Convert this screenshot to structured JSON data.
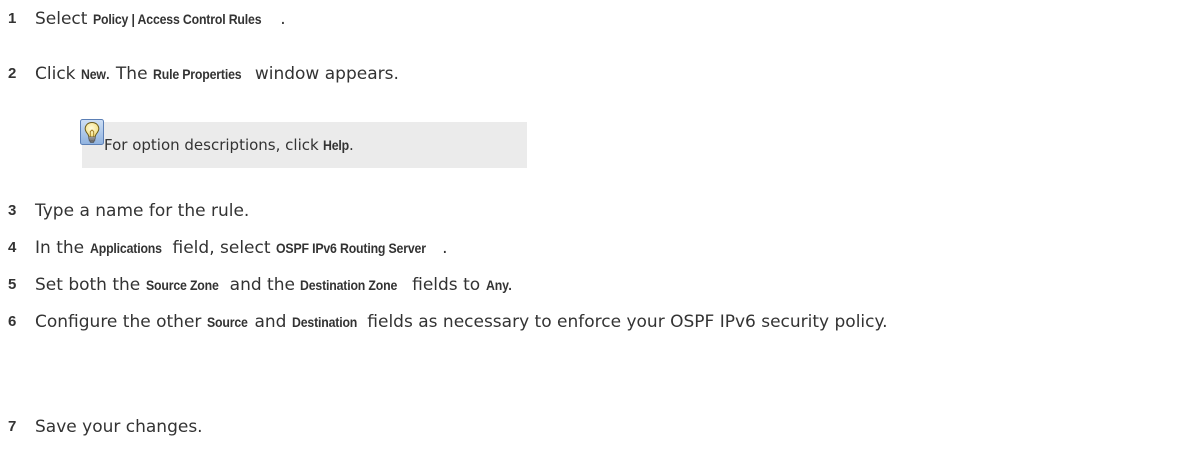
{
  "steps": [
    {
      "num": "1",
      "parts": [
        {
          "t": "Select "
        },
        {
          "t": "Policy | Access Control Rules",
          "ui": true
        },
        {
          "t": "."
        }
      ]
    },
    {
      "num": "2",
      "parts": [
        {
          "t": "Click "
        },
        {
          "t": "New",
          "ui": true
        },
        {
          "t": ". The "
        },
        {
          "t": "Rule Properties",
          "ui": true
        },
        {
          "t": " window appears."
        }
      ]
    },
    {
      "num": "3",
      "parts": [
        {
          "t": "Type a name for the rule."
        }
      ]
    },
    {
      "num": "4",
      "parts": [
        {
          "t": "In the "
        },
        {
          "t": "Applications",
          "ui": true
        },
        {
          "t": " field, select "
        },
        {
          "t": "OSPF IPv6 Routing Server",
          "ui": true
        },
        {
          "t": "."
        }
      ]
    },
    {
      "num": "5",
      "parts": [
        {
          "t": "Set both the "
        },
        {
          "t": "Source Zone",
          "ui": true
        },
        {
          "t": " and the "
        },
        {
          "t": "Destination Zone",
          "ui": true
        },
        {
          "t": " fields to "
        },
        {
          "t": "Any",
          "ui": true
        },
        {
          "t": "."
        }
      ]
    },
    {
      "num": "6",
      "parts": [
        {
          "t": "Configure the other "
        },
        {
          "t": "Source",
          "ui": true
        },
        {
          "t": " and "
        },
        {
          "t": "Destination",
          "ui": true
        },
        {
          "t": " fields as necessary to enforce your OSPF IPv6 security policy."
        }
      ]
    },
    {
      "num": "7",
      "parts": [
        {
          "t": "Save your changes."
        }
      ]
    }
  ],
  "tip": {
    "icon": "lightbulb-icon",
    "parts": [
      {
        "t": "For option descriptions, click "
      },
      {
        "t": "Help",
        "ui": true
      },
      {
        "t": "."
      }
    ]
  }
}
